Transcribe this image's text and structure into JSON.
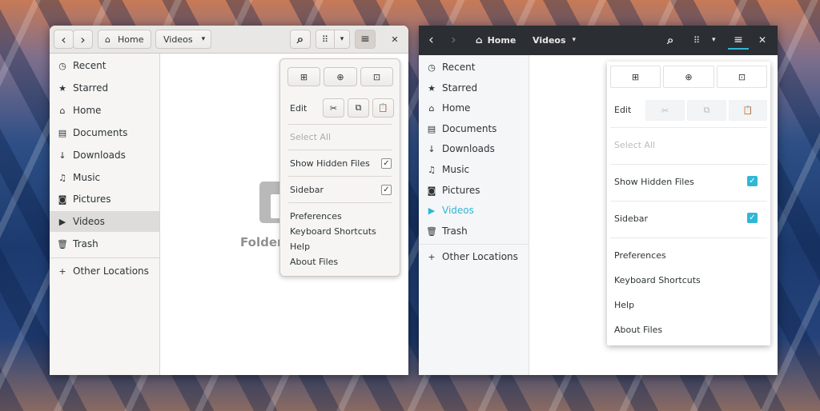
{
  "light": {
    "header": {
      "back_icon": "‹",
      "forward_icon": "›",
      "home_icon": "⌂",
      "crumb_home": "Home",
      "crumb_videos": "Videos",
      "crumb_menu_icon": "▾",
      "search_icon": "⌕",
      "view_icon": "⠿",
      "view_menu_icon": "▾",
      "menu_icon": "≡",
      "close_icon": "✕"
    },
    "sidebar": {
      "items": [
        {
          "icon": "◷",
          "label": "Recent"
        },
        {
          "icon": "★",
          "label": "Starred"
        },
        {
          "icon": "⌂",
          "label": "Home"
        },
        {
          "icon": "▤",
          "label": "Documents"
        },
        {
          "icon": "↓",
          "label": "Downloads"
        },
        {
          "icon": "♫",
          "label": "Music"
        },
        {
          "icon": "◙",
          "label": "Pictures"
        },
        {
          "icon": "▶",
          "label": "Videos"
        },
        {
          "icon": "🗑",
          "label": "Trash"
        }
      ],
      "other": {
        "icon": "+",
        "label": "Other Locations"
      }
    },
    "empty_label": "Folder"
  },
  "dark": {
    "header": {
      "back_icon": "‹",
      "forward_icon": "›",
      "home_icon": "⌂",
      "crumb_home": "Home",
      "crumb_videos": "Videos",
      "crumb_menu_icon": "▾",
      "search_icon": "⌕",
      "view_icon": "⠿",
      "view_menu_icon": "▾",
      "menu_icon": "≡",
      "close_icon": "✕"
    },
    "sidebar": {
      "items": [
        {
          "icon": "◷",
          "label": "Recent"
        },
        {
          "icon": "★",
          "label": "Starred"
        },
        {
          "icon": "⌂",
          "label": "Home"
        },
        {
          "icon": "▤",
          "label": "Documents"
        },
        {
          "icon": "↓",
          "label": "Downloads"
        },
        {
          "icon": "♫",
          "label": "Music"
        },
        {
          "icon": "◙",
          "label": "Pictures"
        },
        {
          "icon": "▶",
          "label": "Videos"
        },
        {
          "icon": "🗑",
          "label": "Trash"
        }
      ],
      "other": {
        "icon": "+",
        "label": "Other Locations"
      }
    }
  },
  "menu": {
    "new_window_icon": "⊞",
    "new_tab_icon": "⊕",
    "new_folder_icon": "⊡",
    "edit_label": "Edit",
    "cut_icon": "✂",
    "copy_icon": "⧉",
    "paste_icon": "📋",
    "select_all": "Select All",
    "show_hidden": "Show Hidden Files",
    "sidebar": "Sidebar",
    "preferences": "Preferences",
    "shortcuts": "Keyboard Shortcuts",
    "help": "Help",
    "about": "About Files",
    "check_mark": "✓"
  },
  "colors": {
    "accent_dark_theme": "#2fb7d6",
    "dark_headerbar": "#2b2e33",
    "light_headerbar": "#e8e7e6"
  }
}
